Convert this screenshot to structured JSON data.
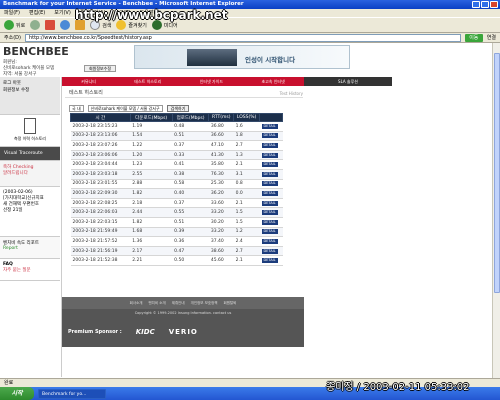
{
  "window": {
    "title": "Benchmark for your Internet Service - Benchbee - Microsoft Internet Explorer",
    "menu": [
      "파일(F)",
      "편집(E)",
      "보기(V)",
      "즐겨찾기(A)",
      "도구(T)",
      "도움말(H)"
    ],
    "toolbar": {
      "back": "뒤로",
      "search": "검색",
      "favorites": "즐겨찾기",
      "media": "미디어"
    },
    "address_label": "주소(D)",
    "address": "http://www.benchbee.co.kr/Speedtest/history.asp",
    "go_label": "이동",
    "links_label": "연결"
  },
  "overlay_url": "http://www.bcpark.net",
  "site": {
    "logo": "BENCHBEE",
    "user_line1": "회원님:",
    "user_line2": "신비로sohark 케이블 모뎀",
    "user_line3": "지역: 서울 강서구",
    "login_button": "회원정보수정",
    "banner_text": "인성이 시작합니다",
    "sidebar": {
      "top_links": [
        "로그 아웃",
        "회원정보 수정"
      ],
      "history_label": "측정 이력 히스토리",
      "dark_label": "Visual Traceroute",
      "promo_label": "축하 Checking",
      "promo_sub": "알려드립니다",
      "list_items": [
        "(2003-02-06)",
        "[가치대학교]신규지표",
        "새 건재택 우편번호",
        "선정 21일"
      ],
      "report_title": "벤치비 속도 리포트",
      "report_sub": "Report",
      "faq_title": "FAQ",
      "faq_sub": "자주 묻는 질문"
    },
    "nav": [
      "커뮤니티",
      "테스트 히스토리",
      "인터넷 가이드",
      "초고속 인터넷",
      "SLA 솔루션"
    ],
    "pane": {
      "title": "테스트 히스토리",
      "crumb": "Test History",
      "filter_scope": "국 내",
      "filter_line": "신비로sohark 케이블 모뎀 / 서울 강서구",
      "search_button": "검색하기"
    },
    "table": {
      "headers": [
        "시 간",
        "다운로드(Mbps)",
        "업로드(Mbps)",
        "RTT(ms)",
        "LOSS(%)",
        ""
      ],
      "detail_label": "DETAIL",
      "rows": [
        [
          "2003-2-18 23:15:23",
          "1.19",
          "0.48",
          "36.80",
          "1.6"
        ],
        [
          "2003-2-18 23:13:06",
          "1.54",
          "0.51",
          "36.60",
          "1.8"
        ],
        [
          "2003-2-18 23:07:26",
          "1.22",
          "0.37",
          "47.10",
          "2.7"
        ],
        [
          "2003-2-18 23:06:06",
          "1.20",
          "0.33",
          "41.30",
          "1.3"
        ],
        [
          "2003-2-18 23:04:44",
          "1.23",
          "0.41",
          "35.80",
          "2.1"
        ],
        [
          "2003-2-18 23:03:18",
          "2.55",
          "0.38",
          "76.30",
          "3.1"
        ],
        [
          "2003-2-18 23:01:55",
          "2.88",
          "0.58",
          "25.30",
          "0.8"
        ],
        [
          "2003-2-18 22:09:30",
          "1.82",
          "0.40",
          "36.20",
          "0.0"
        ],
        [
          "2003-2-18 22:08:25",
          "2.18",
          "0.37",
          "33.60",
          "2.1"
        ],
        [
          "2003-2-18 22:06:03",
          "2.44",
          "0.55",
          "33.20",
          "1.5"
        ],
        [
          "2003-2-18 22:03:15",
          "1.82",
          "0.51",
          "30.20",
          "1.5"
        ],
        [
          "2003-2-18 21:59:49",
          "1.68",
          "0.39",
          "33.20",
          "1.2"
        ],
        [
          "2003-2-18 21:57:52",
          "1.36",
          "0.36",
          "37.40",
          "2.4"
        ],
        [
          "2003-2-18 21:56:19",
          "2.17",
          "0.47",
          "38.60",
          "2.7"
        ],
        [
          "2003-2-18 21:52:38",
          "2.21",
          "0.50",
          "45.60",
          "2.1"
        ]
      ]
    },
    "footer": {
      "links": [
        "회사소개",
        "벤치비 소개",
        "제휴안내",
        "개인정보 보호정책",
        "회원탈퇴"
      ],
      "copyright": "Copyright © 1999-2002 Insung Information. contact us",
      "sponsor_label": "Premium Sponsor :",
      "sponsor1": "KIDC",
      "sponsor2": "VERIO"
    }
  },
  "status": "완료",
  "taskbar": {
    "start": "시작",
    "items": [
      "Benchmark for yo..."
    ]
  },
  "watermark": "종미정 / 2003-02-11 05:33:02"
}
